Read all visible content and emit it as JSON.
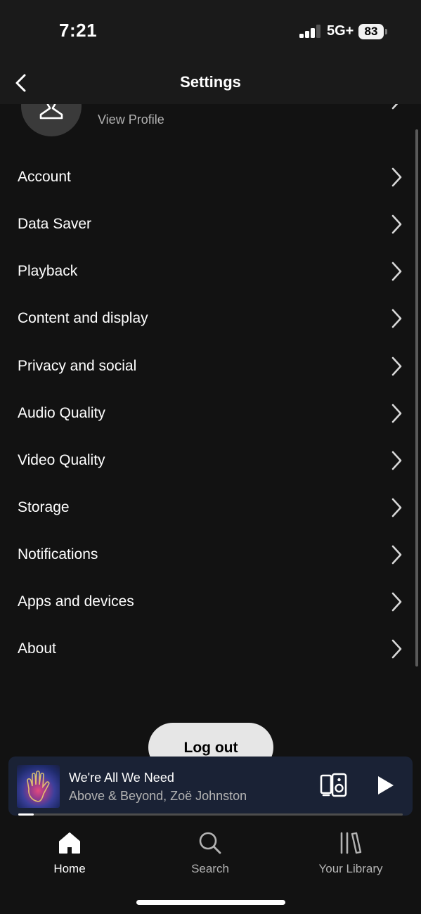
{
  "status_bar": {
    "time": "7:21",
    "network": "5G+",
    "battery": "83",
    "signal_bars_active": 3,
    "signal_bars_total": 4
  },
  "header": {
    "title": "Settings",
    "back_icon": "chevron-left-icon"
  },
  "profile": {
    "name": "####",
    "view_profile_label": "View Profile",
    "avatar_icon": "user-icon"
  },
  "menu": {
    "items": [
      {
        "label": "Account"
      },
      {
        "label": "Data Saver"
      },
      {
        "label": "Playback"
      },
      {
        "label": "Content and display"
      },
      {
        "label": "Privacy and social"
      },
      {
        "label": "Audio Quality"
      },
      {
        "label": "Video Quality"
      },
      {
        "label": "Storage"
      },
      {
        "label": "Notifications"
      },
      {
        "label": "Apps and devices"
      },
      {
        "label": "About"
      }
    ]
  },
  "logout": {
    "label": "Log out"
  },
  "player": {
    "title": "We're All We Need",
    "artist": "Above & Beyond, Zoë Johnston",
    "progress": 0.01,
    "device_icon": "connect-device-icon",
    "play_icon": "play-icon"
  },
  "nav": {
    "items": [
      {
        "label": "Home",
        "icon": "home-icon",
        "active": true
      },
      {
        "label": "Search",
        "icon": "search-icon",
        "active": false
      },
      {
        "label": "Your Library",
        "icon": "library-icon",
        "active": false
      }
    ]
  },
  "colors": {
    "background": "#121212",
    "header": "#1a1a1a",
    "player": "#1a2235",
    "text_secondary": "#b3b3b3",
    "logout_button": "#e6e6e6"
  }
}
